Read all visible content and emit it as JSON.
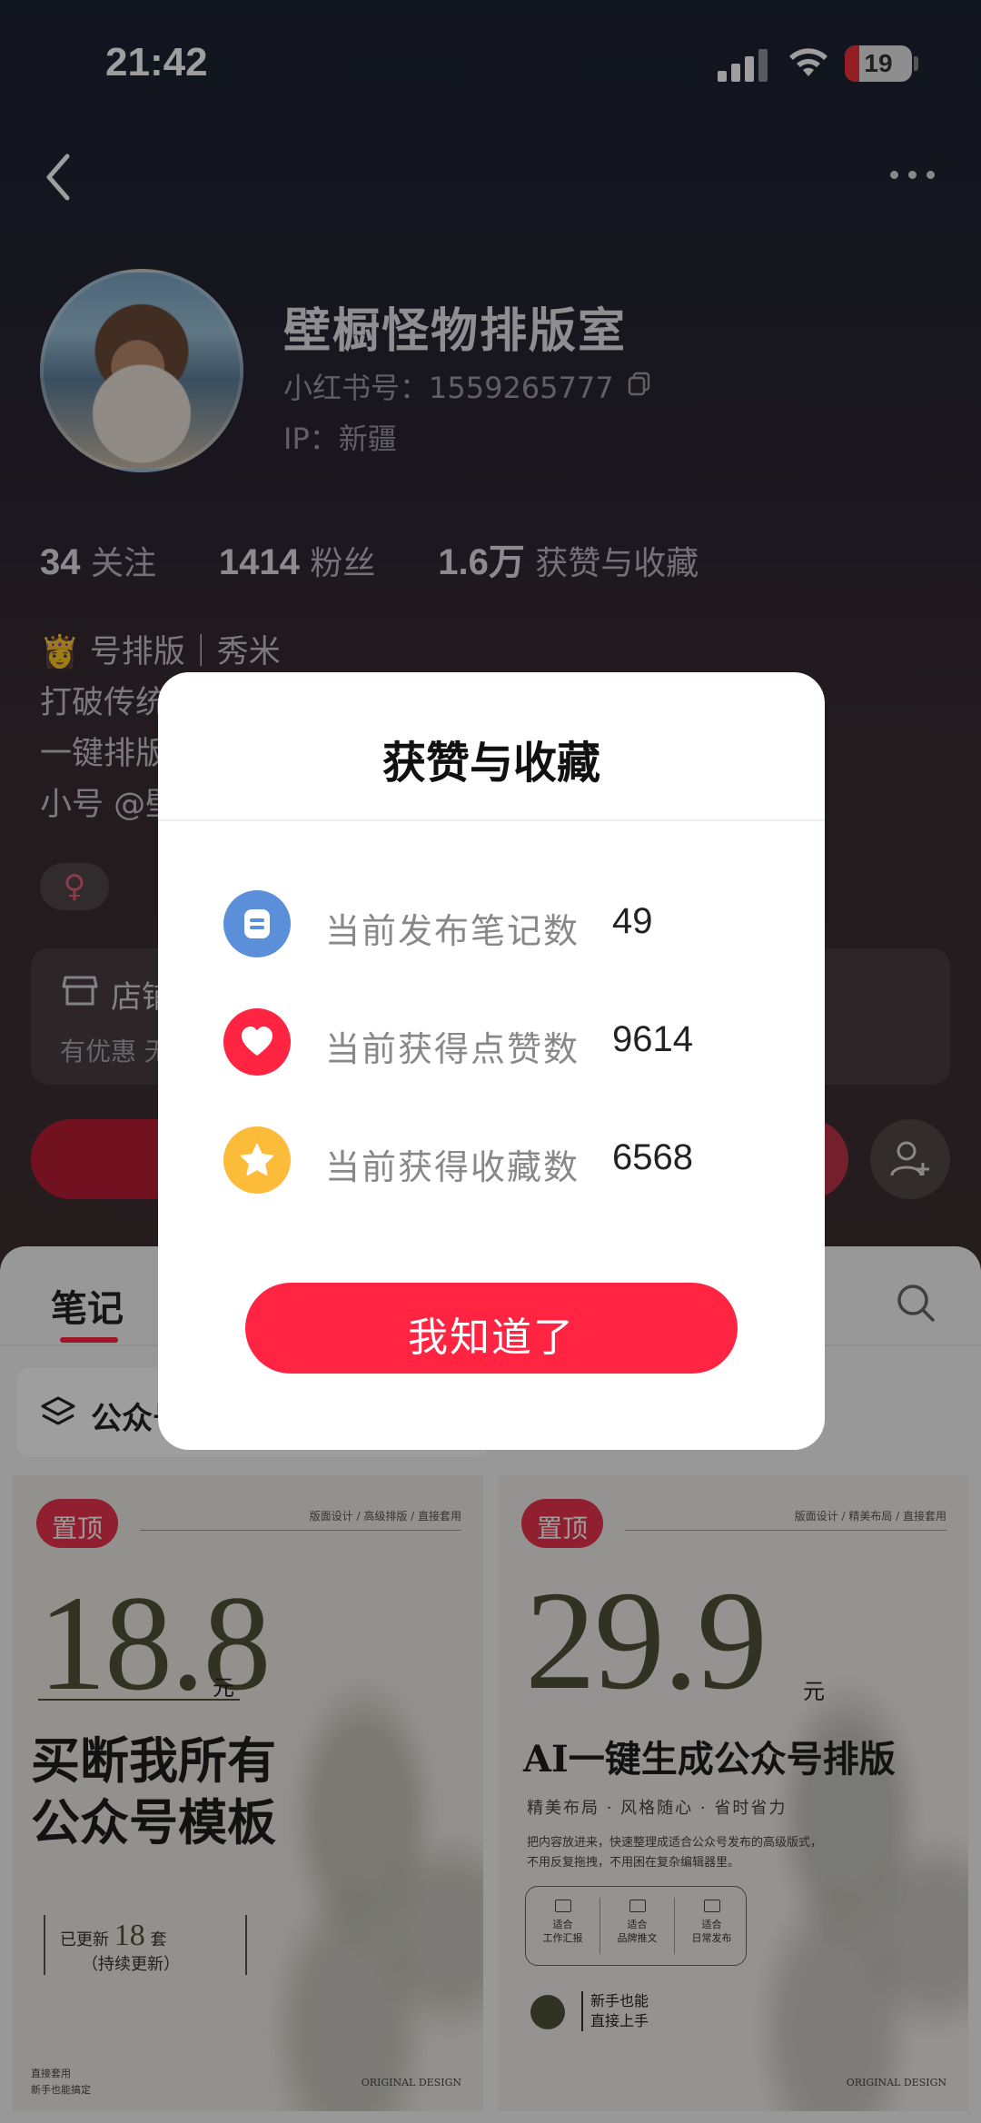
{
  "status_bar": {
    "time": "21:42",
    "battery": "19",
    "battery_level": 0.19
  },
  "profile": {
    "name": "壁橱怪物排版室",
    "redbook_id": "小红书号：1559265777",
    "ip": "IP：新疆",
    "following_count": "34",
    "following_label": "关注",
    "followers_count": "1414",
    "followers_label": "粉丝",
    "likes_count": "1.6万",
    "likes_label": "获赞与收藏",
    "bio": [
      "👸 号排版｜秀米",
      "打破传统",
      "一键排版",
      "小号 @壁"
    ],
    "gender_symbol": "♀",
    "shop_title": "店铺",
    "shop_sub": "有优惠 无"
  },
  "tabs": {
    "notes": "笔记"
  },
  "collection_chip": "公众号",
  "notes": [
    {
      "pin": "置顶",
      "tag": "版面设计 / 高级排版 / 直接套用",
      "price": "18.8",
      "unit": "元",
      "headline_1": "买断我所有",
      "headline_2": "公众号模板",
      "update_prefix": "已更新",
      "update_count": "18",
      "update_suffix": "套",
      "update_note": "（持续更新）",
      "foot_left_1": "直接套用",
      "foot_left_2": "新手也能搞定",
      "foot_right": "ORIGINAL DESIGN"
    },
    {
      "pin": "置顶",
      "tag": "版面设计 / 精美布局 / 直接套用",
      "price": "29.9",
      "unit": "元",
      "headline": "AI一键生成公众号排版",
      "sub": "精美布局 · 风格随心 · 省时省力",
      "para_1": "把内容放进来，快速整理成适合公众号发布的高级版式，",
      "para_2": "不用反复拖拽，不用困在复杂编辑器里。",
      "features": [
        "适合\n工作汇报",
        "适合\n品牌推文",
        "适合\n日常发布"
      ],
      "newbie_1": "新手也能",
      "newbie_2": "直接上手",
      "foot_right": "ORIGINAL DESIGN"
    }
  ],
  "dialog": {
    "title": "获赞与收藏",
    "rows": [
      {
        "label": "当前发布笔记数",
        "value": "49",
        "icon": "note-icon",
        "color": "#5b8fd9"
      },
      {
        "label": "当前获得点赞数",
        "value": "9614",
        "icon": "heart-icon",
        "color": "#ff2442"
      },
      {
        "label": "当前获得收藏数",
        "value": "6568",
        "icon": "star-icon",
        "color": "#fdbb3a"
      }
    ],
    "button": "我知道了"
  }
}
